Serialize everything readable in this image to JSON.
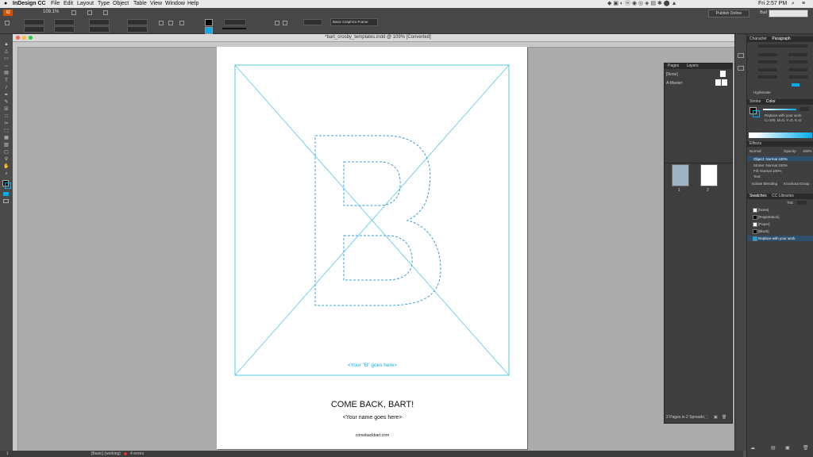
{
  "menubar": {
    "app": "InDesign CC",
    "items": [
      "File",
      "Edit",
      "Layout",
      "Type",
      "Object",
      "Table",
      "View",
      "Window",
      "Help"
    ],
    "clock": "Fri 2:57 PM"
  },
  "control": {
    "zoom": "109.1%",
    "swatch_name": "Basic Graphics Frame",
    "publish_label": "Publish Online",
    "user": "Bud"
  },
  "document": {
    "title": "*bart_crosby_templates.indd @ 109% [Converted]",
    "b_placeholder": "<Your \"B\" goes here>",
    "headline": "COME BACK, BART!",
    "name_placeholder": "<Your name goes here>",
    "url": "comebackbart.com"
  },
  "pages_panel": {
    "tabs": [
      "Pages",
      "Layers"
    ],
    "none_label": "[None]",
    "master_label": "A-Master",
    "page_numbers": [
      "1",
      "2"
    ],
    "footer": "2 Pages in 2 Spreads"
  },
  "right_panels": {
    "character_tab": "Character",
    "paragraph_tab": "Paragraph",
    "hyphenate": "Hyphenate",
    "stroke_tab": "Stroke",
    "color_tab": "Color",
    "color_swatch_name": "Replace with your work",
    "color_values": "C=100, M=0, Y=0, K=0",
    "effects_title": "Effects",
    "blend_mode": "Normal",
    "opacity_label": "Opacity:",
    "opacity_value": "100%",
    "effects_rows": [
      "Object: Normal 100%",
      "Stroke: Normal 100%",
      "Fill: Normal 100%",
      "Text:"
    ],
    "isolate": "Isolate Blending",
    "knockout": "Knockout Group",
    "swatches_tab": "Swatches",
    "cc_libraries_tab": "CC Libraries",
    "tint_label": "Tint:",
    "swatches": [
      {
        "name": "[None]",
        "color": "#ffffff"
      },
      {
        "name": "[Registration]",
        "color": "#000000"
      },
      {
        "name": "[Paper]",
        "color": "#ffffff"
      },
      {
        "name": "[Black]",
        "color": "#000000"
      },
      {
        "name": "Replace with your work",
        "color": "#00aeef"
      }
    ]
  },
  "statusbar": {
    "page_num": "1",
    "profile": "[Basic] (working)",
    "errors": "4 errors"
  },
  "colors": {
    "accent": "#00aeef",
    "guide": "#56c7ea",
    "b_outline": "#3aa0d8"
  }
}
